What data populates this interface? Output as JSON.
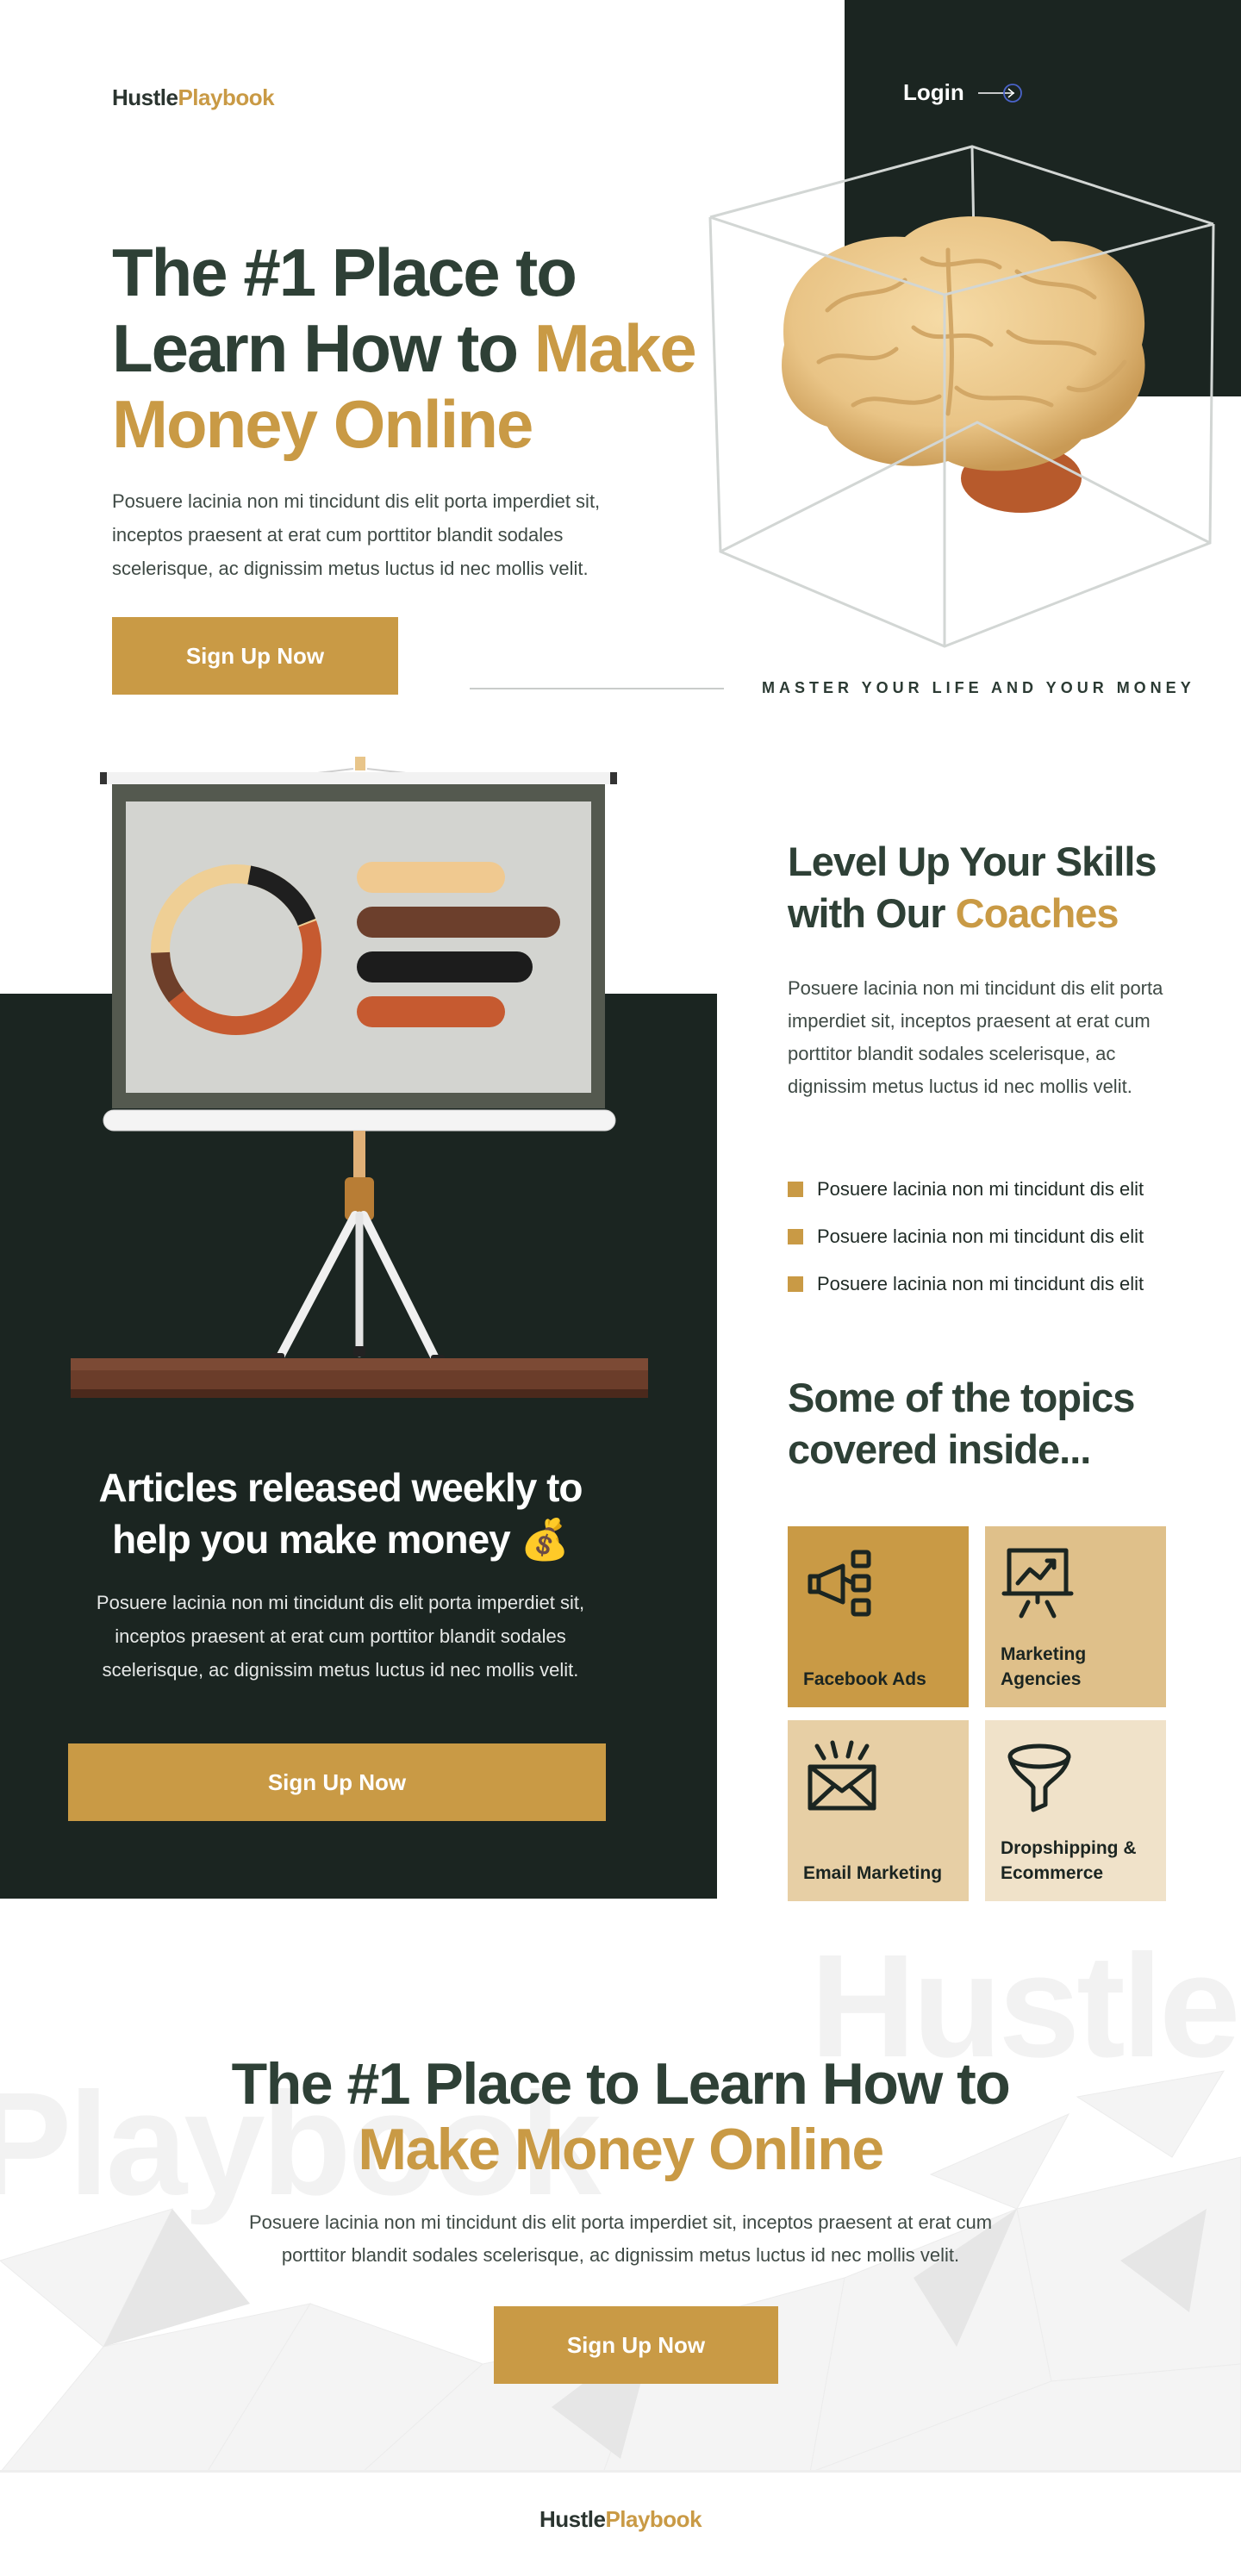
{
  "brand": {
    "part1": "Hustle",
    "part2": "Playbook",
    "accent": "#c99a45",
    "dark": "#1b2521",
    "heading": "#2e4036"
  },
  "nav": {
    "login_label": "Login",
    "login_icon": "arrow-right-circle-icon"
  },
  "hero": {
    "title_line1": "The #1 Place to",
    "title_line2_a": "Learn How to ",
    "title_line2_b": "Make",
    "title_line3": "Money Online",
    "description": "Posuere lacinia non mi tincidunt dis elit porta imperdiet sit, inceptos praesent at erat cum porttitor blandit sodales scelerisque, ac dignissim metus luctus id nec mollis velit.",
    "cta_label": "Sign Up Now",
    "tagline": "MASTER YOUR LIFE AND YOUR MONEY",
    "illustration": "brain-in-wire-cube"
  },
  "coaches": {
    "title_a": "Level Up Your Skills with Our ",
    "title_b": "Coaches",
    "description": "Posuere lacinia non mi tincidunt dis elit porta imperdiet sit, inceptos praesent at erat cum porttitor blandit sodales scelerisque, ac dignissim metus luctus id nec mollis velit.",
    "items": [
      "Posuere lacinia non mi tincidunt dis elit",
      "Posuere lacinia non mi tincidunt dis elit",
      "Posuere lacinia non mi tincidunt dis elit"
    ]
  },
  "articles": {
    "title": "Articles released weekly to help you make money 💰",
    "description": "Posuere lacinia non mi tincidunt dis elit porta imperdiet sit, inceptos praesent at erat cum porttitor blandit sodales scelerisque, ac dignissim metus luctus id nec mollis velit.",
    "cta_label": "Sign Up Now",
    "illustration": "presentation-board-on-tripod"
  },
  "topics": {
    "title": "Some of the topics covered inside...",
    "items": [
      {
        "label": "Facebook Ads",
        "icon": "megaphone-icon"
      },
      {
        "label": "Marketing Agencies",
        "icon": "presentation-chart-icon"
      },
      {
        "label": "Email Marketing",
        "icon": "envelope-icon"
      },
      {
        "label": "Dropshipping & Ecommerce",
        "icon": "funnel-icon"
      }
    ]
  },
  "cta": {
    "title_line1": "The #1 Place to Learn How to",
    "title_line2": "Make Money Online",
    "description": "Posuere lacinia non mi tincidunt dis elit porta imperdiet sit, inceptos praesent at erat cum porttitor blandit sodales scelerisque, ac dignissim metus luctus id nec mollis velit.",
    "cta_label": "Sign Up Now",
    "watermark_1": "Hustle",
    "watermark_2": "Playbook"
  },
  "footer": {
    "logo_part1": "Hustle",
    "logo_part2": "Playbook"
  }
}
